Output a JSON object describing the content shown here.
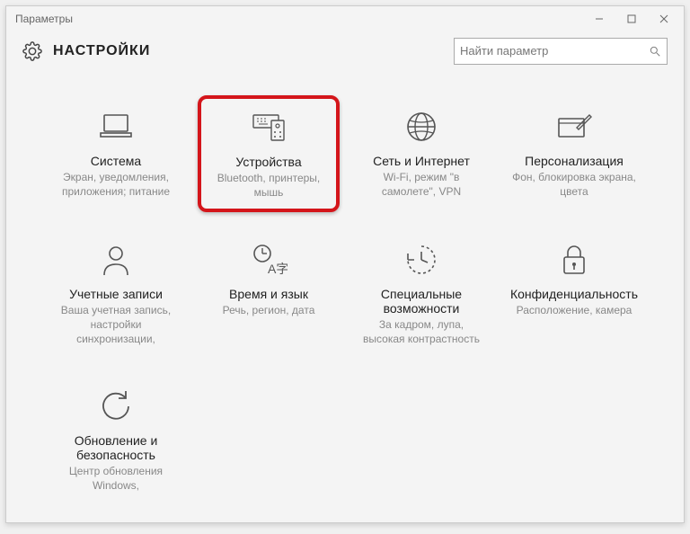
{
  "window": {
    "title": "Параметры"
  },
  "header": {
    "title": "НАСТРОЙКИ"
  },
  "search": {
    "placeholder": "Найти параметр"
  },
  "tiles": {
    "system": {
      "title": "Система",
      "desc": "Экран, уведомления, приложения; питание"
    },
    "devices": {
      "title": "Устройства",
      "desc": "Bluetooth, принтеры, мышь"
    },
    "network": {
      "title": "Сеть и Интернет",
      "desc": "Wi-Fi, режим \"в самолете\", VPN"
    },
    "personalize": {
      "title": "Персонализация",
      "desc": "Фон, блокировка экрана, цвета"
    },
    "accounts": {
      "title": "Учетные записи",
      "desc": "Ваша учетная запись, настройки синхронизации,"
    },
    "timelang": {
      "title": "Время и язык",
      "desc": "Речь, регион, дата"
    },
    "ease": {
      "title": "Специальные возможности",
      "desc": "За кадром, лупа, высокая контрастность"
    },
    "privacy": {
      "title": "Конфиденциальность",
      "desc": "Расположение, камера"
    },
    "update": {
      "title": "Обновление и безопасность",
      "desc": "Центр обновления Windows,"
    }
  }
}
